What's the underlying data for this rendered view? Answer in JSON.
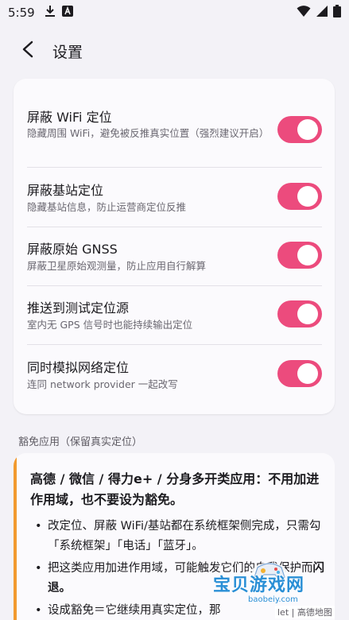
{
  "status_bar": {
    "time": "5:59",
    "icons": [
      "download-icon",
      "app-notification-icon",
      "wifi-icon",
      "signal-icon",
      "battery-icon"
    ]
  },
  "app_bar": {
    "back_icon": "arrow-back-icon",
    "title": "设置"
  },
  "settings": [
    {
      "title": "屏蔽 WiFi 定位",
      "desc": "隐藏周围 WiFi，避免被反推真实位置（强烈建议开启）",
      "enabled": true
    },
    {
      "title": "屏蔽基站定位",
      "desc": "隐藏基站信息，防止运营商定位反推",
      "enabled": true
    },
    {
      "title": "屏蔽原始 GNSS",
      "desc": "屏蔽卫星原始观测量，防止应用自行解算",
      "enabled": true
    },
    {
      "title": "推送到测试定位源",
      "desc": "室内无 GPS 信号时也能持续输出定位",
      "enabled": true
    },
    {
      "title": "同时模拟网络定位",
      "desc": "连同 network provider 一起改写",
      "enabled": true
    }
  ],
  "exempt_section": {
    "label": "豁免应用（保留真实定位）",
    "headline": "高德 / 微信 / 得力e+ / 分身多开类应用：不用加进作用域，也不要设为豁免。",
    "bullets": [
      {
        "text": "改定位、屏蔽 WiFi/基站都在系统框架侧完成，只需勾「系统框架」「电话」「蓝牙」。",
        "bold": ""
      },
      {
        "text": "把这类应用加进作用域，可能触发它们的自我保护而",
        "bold": "闪退。"
      },
      {
        "text": "设成豁免＝它继续用真实定位，那",
        "bold": ""
      }
    ]
  },
  "watermark": {
    "brand": "宝贝游戏网",
    "site": "baobeiy.com",
    "attribution": "let | 高德地图"
  },
  "colors": {
    "accent": "#ec4b7d",
    "note_bar": "#f29a2e",
    "background": "#f3f2f7",
    "card": "#fbfafd"
  }
}
